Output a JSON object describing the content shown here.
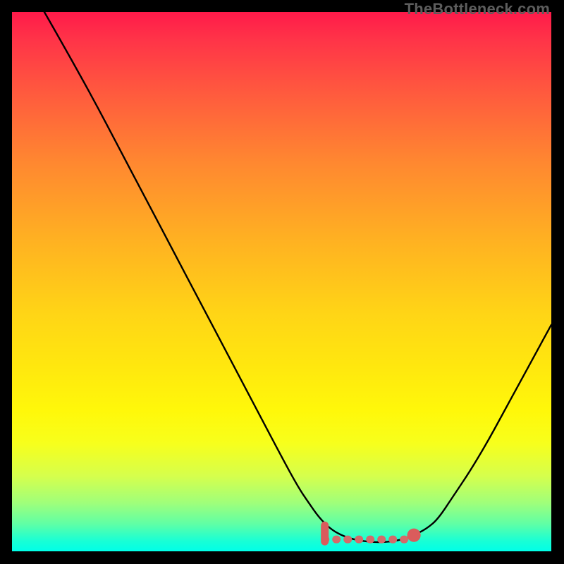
{
  "watermark": {
    "text": "TheBottleneck.com"
  },
  "chart_data": {
    "type": "line",
    "title": "",
    "xlabel": "",
    "ylabel": "",
    "xlim": [
      0,
      100
    ],
    "ylim": [
      0,
      100
    ],
    "curve": {
      "name": "bottleneck-curve",
      "color": "#000000",
      "points_xy": [
        [
          6,
          100
        ],
        [
          10,
          93
        ],
        [
          15,
          84
        ],
        [
          20,
          74.5
        ],
        [
          25,
          65
        ],
        [
          30,
          55.5
        ],
        [
          35,
          46
        ],
        [
          40,
          36.5
        ],
        [
          45,
          27
        ],
        [
          50,
          17.5
        ],
        [
          53,
          12
        ],
        [
          55,
          9
        ],
        [
          57,
          6.2
        ],
        [
          59,
          4.2
        ],
        [
          61,
          3.0
        ],
        [
          63,
          2.3
        ],
        [
          65,
          1.9
        ],
        [
          67,
          1.7
        ],
        [
          69,
          1.7
        ],
        [
          71,
          1.9
        ],
        [
          73,
          2.4
        ],
        [
          75,
          3.2
        ],
        [
          77,
          4.3
        ],
        [
          79,
          6.0
        ],
        [
          82,
          10.5
        ],
        [
          85,
          15
        ],
        [
          88,
          20
        ],
        [
          91,
          25.5
        ],
        [
          94,
          31
        ],
        [
          97,
          36.5
        ],
        [
          100,
          42
        ]
      ]
    },
    "flat_zone": {
      "label": "optimal-range",
      "color": "#d46a6a",
      "cap_color": "#da5c5c",
      "x_start": 58,
      "x_end": 74,
      "y": 2.2,
      "start_tick_height": 2.6,
      "end_dot_radius": 1.25
    },
    "background": {
      "gradient_stops_pct_color": [
        [
          0,
          "#ff1a4a"
        ],
        [
          5,
          "#ff3348"
        ],
        [
          15,
          "#ff5a3e"
        ],
        [
          28,
          "#ff8830"
        ],
        [
          43,
          "#ffb321"
        ],
        [
          56,
          "#ffd516"
        ],
        [
          66,
          "#ffe80e"
        ],
        [
          74,
          "#fff80a"
        ],
        [
          80,
          "#f7ff1c"
        ],
        [
          86,
          "#d6ff4c"
        ],
        [
          91,
          "#a0ff7a"
        ],
        [
          95,
          "#5effa6"
        ],
        [
          98,
          "#1affd4"
        ],
        [
          100,
          "#00ffe8"
        ]
      ]
    }
  }
}
